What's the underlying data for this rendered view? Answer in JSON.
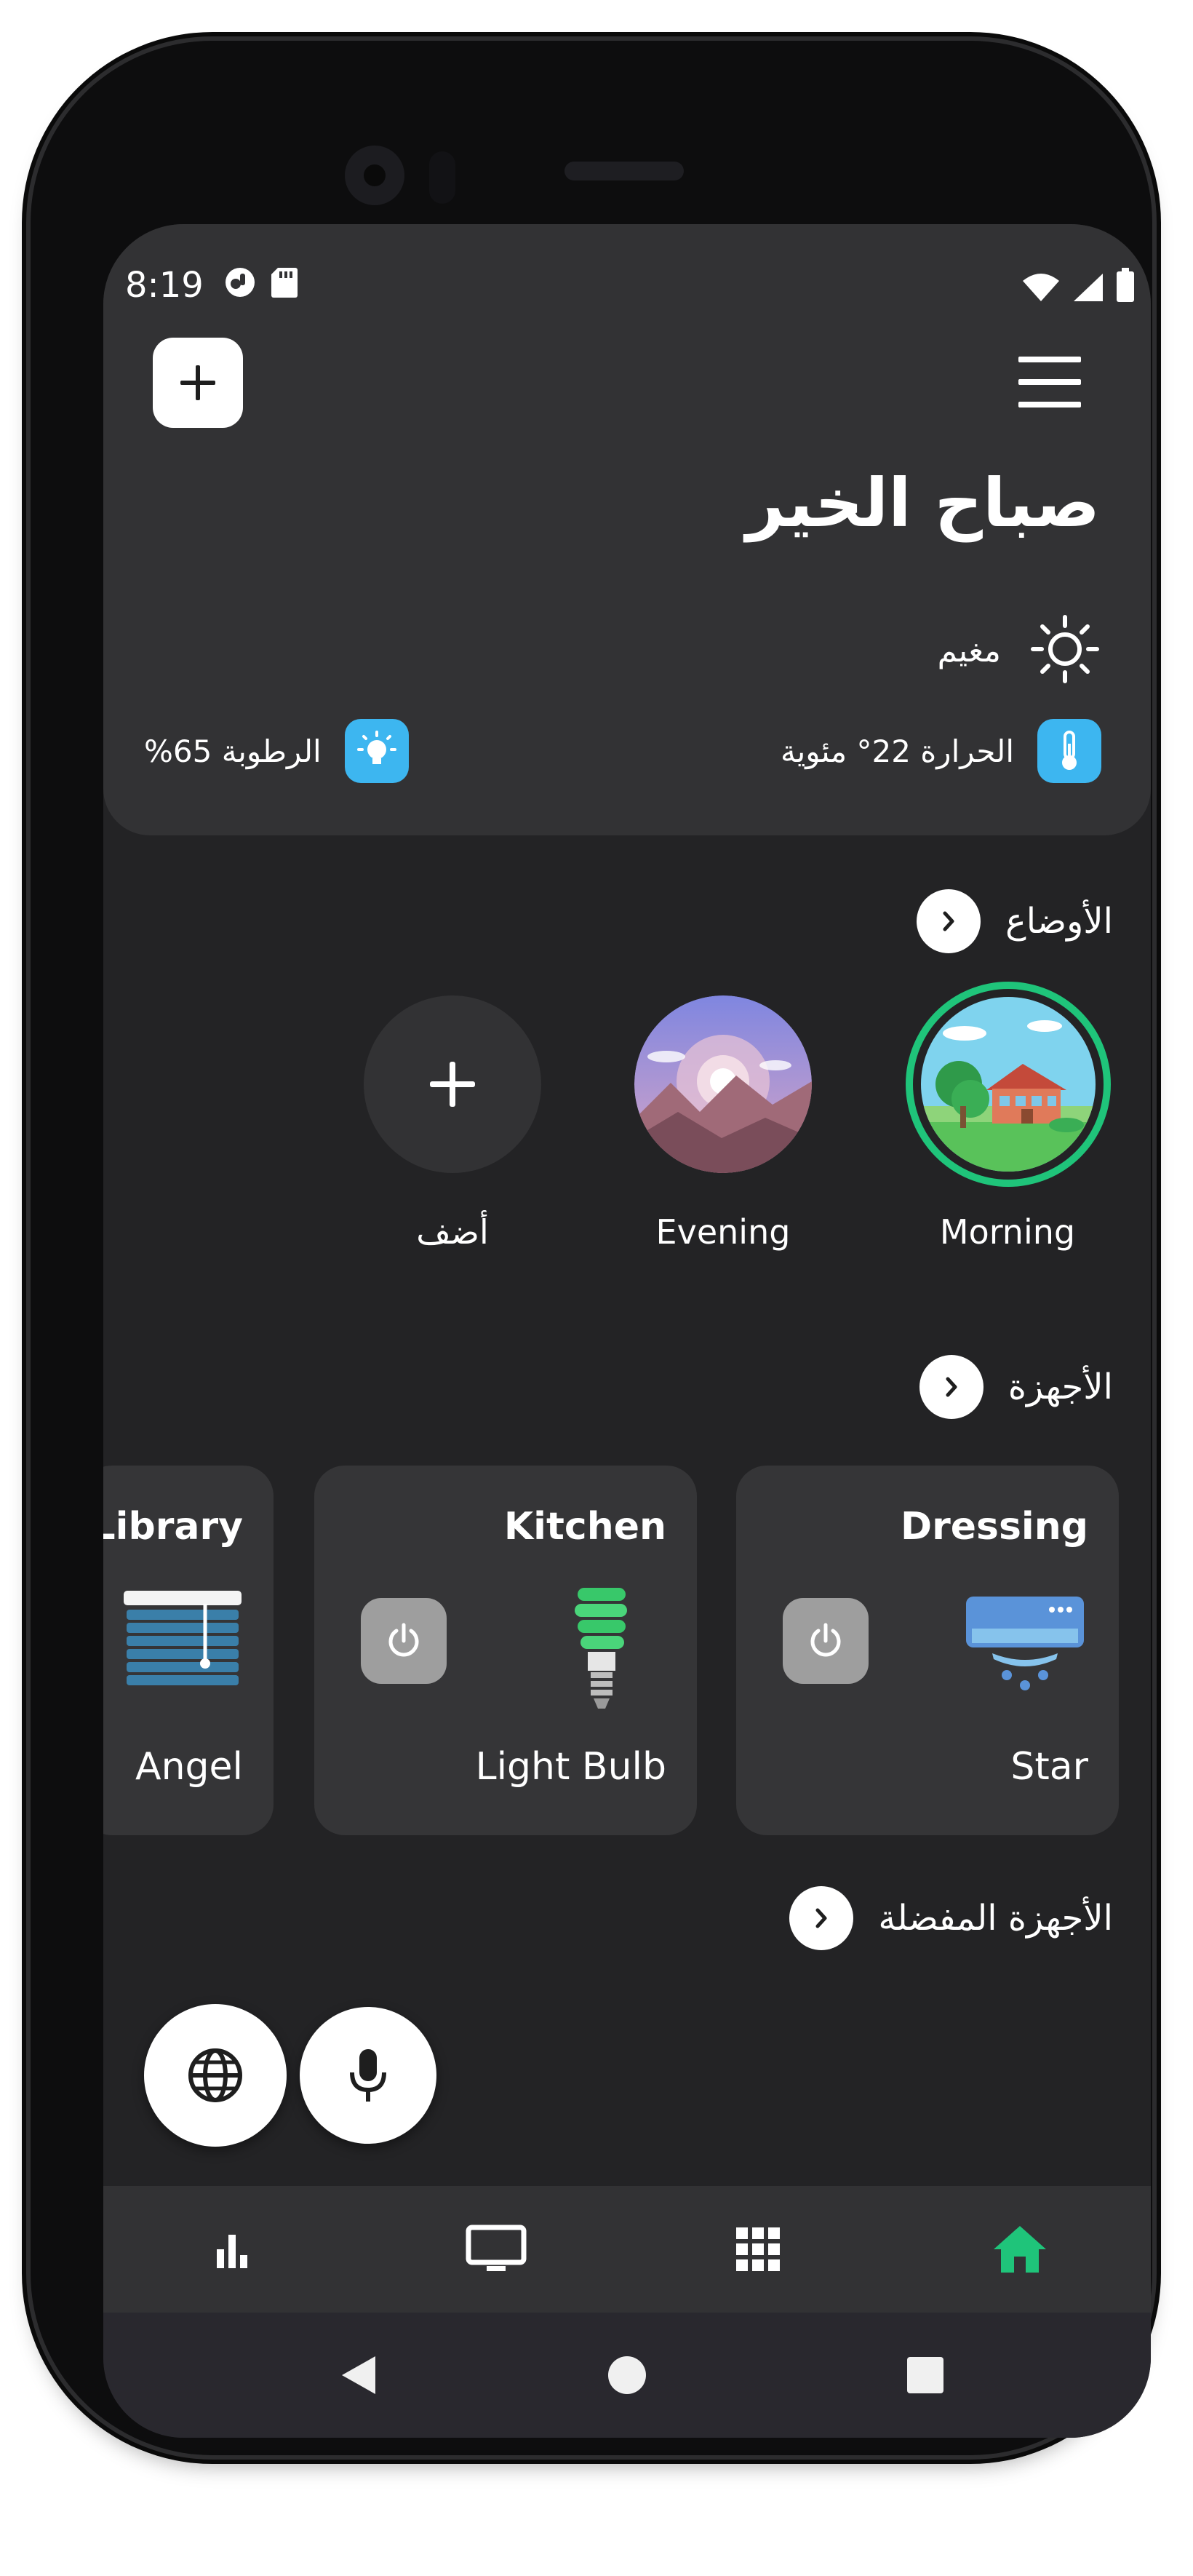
{
  "status_bar": {
    "time": "8:19",
    "left_icons": [
      "notification-app-icon",
      "sd-card-icon"
    ],
    "right_icons": [
      "wifi-icon",
      "cell-signal-icon",
      "battery-icon"
    ]
  },
  "header": {
    "add_button_icon": "plus-icon",
    "menu_icon": "hamburger-menu-icon",
    "greeting": "صباح الخير",
    "weather": {
      "icon": "sun-icon",
      "condition": "مغيم"
    },
    "temperature": {
      "icon": "thermometer-icon",
      "text": "الحرارة 22° مئوية"
    },
    "humidity": {
      "icon": "humidity-icon",
      "text": "الرطوبة 65%"
    }
  },
  "modes": {
    "title": "الأوضاع",
    "items": [
      {
        "label": "Morning",
        "selected": true
      },
      {
        "label": "Evening",
        "selected": false
      },
      {
        "label": "أضف",
        "icon": "plus-icon"
      }
    ]
  },
  "devices": {
    "title": "الأجهزة",
    "items": [
      {
        "room": "Dressing",
        "name": "Star",
        "icon": "air-conditioner-icon",
        "power_icon": "power-icon"
      },
      {
        "room": "Kitchen",
        "name": "Light Bulb",
        "icon": "light-bulb-icon",
        "power_icon": "power-icon"
      },
      {
        "room": "Library",
        "name": "Angel",
        "icon": "window-blinds-icon"
      }
    ]
  },
  "favorites": {
    "title": "الأجهزة المفضلة"
  },
  "fabs": {
    "language_icon": "globe-icon",
    "voice_icon": "microphone-icon"
  },
  "bottom_nav": {
    "items": [
      {
        "icon": "bar-chart-icon",
        "active": false
      },
      {
        "icon": "monitor-icon",
        "active": false
      },
      {
        "icon": "grid-icon",
        "active": false
      },
      {
        "icon": "home-icon",
        "active": true
      }
    ],
    "active_color": "#1fc47a",
    "inactive_color": "#ffffff"
  },
  "system_nav": {
    "items": [
      "back-icon",
      "home-circle-icon",
      "recents-icon"
    ]
  },
  "colors": {
    "background": "#232325",
    "card": "#323234",
    "device_card": "#353537",
    "accent_green": "#1fc47a",
    "stat_blue": "#3db6f0",
    "power_grey": "#9e9e9e"
  }
}
